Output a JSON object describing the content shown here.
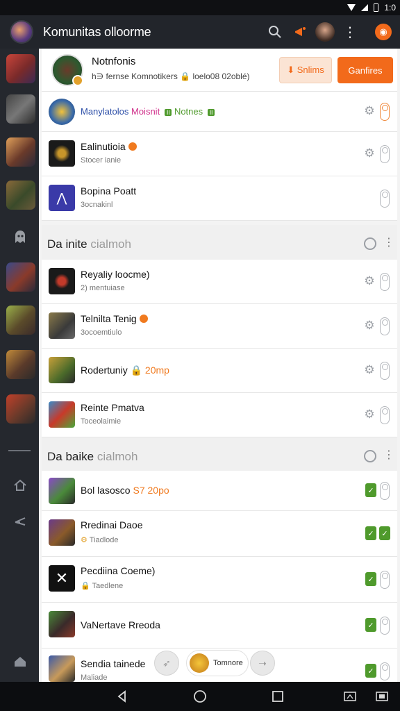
{
  "status_bar": {
    "time": "1:0"
  },
  "header": {
    "title": "Komunitas olloorme",
    "icons": [
      "search-icon",
      "megaphone-icon",
      "avatar",
      "more-vert-icon",
      "orange-circle-icon"
    ]
  },
  "left_rail": {
    "icons": [
      "ghost-icon",
      "home-icon",
      "arrow-icon",
      "chat-icon"
    ]
  },
  "top_card": {
    "title": "Notnfonis",
    "subtitle": "h∋ fernse Komnotikers  🔒 loelo08 02oblé)",
    "light_button": "⬇ Snlims",
    "primary_button": "Ganfires"
  },
  "rows_a": [
    {
      "title_blue": "Manylatolos",
      "title_pink": "Moisnit",
      "chip1": "Il",
      "title_green": "Notnes",
      "chip2": "Il",
      "sub": ""
    },
    {
      "title": "Ealinutioia",
      "sub": "Stocer ianie"
    },
    {
      "title": "Bopina Poatt",
      "sub": "3ocnakinl"
    }
  ],
  "section1": {
    "title": "Da inite",
    "title_faded": "cialmoh"
  },
  "rows_b": [
    {
      "title": "Reyaliy loocme)",
      "sub": "2) mentuiase"
    },
    {
      "title": "Telnilta Tenig",
      "sub": "3ocoemtiulo"
    },
    {
      "title": "Rodertuniy",
      "tag": "20mp",
      "sub": ""
    },
    {
      "title": "Reinte Pmatva",
      "sub": "Toceolaimie"
    }
  ],
  "section2": {
    "title": "Da baike",
    "title_faded": "cialmoh"
  },
  "rows_c": [
    {
      "title": "Bol lasosco",
      "tag": "S7 20po",
      "sub": ""
    },
    {
      "title": "Rredinai Daoe",
      "sub": "Tiadlode"
    },
    {
      "title": "Pecdiina Coeme)",
      "sub": "Taedlene"
    },
    {
      "title": "VaNertave Rreoda",
      "sub": ""
    },
    {
      "title": "Sendia tainede",
      "sub": "Maliade"
    }
  ],
  "floating_bar": {
    "label": "Tomnore"
  },
  "colors": {
    "accent": "#f26a1b",
    "header_bg": "#22252b",
    "rail_bg": "#25282e",
    "green": "#4f9a2c"
  }
}
